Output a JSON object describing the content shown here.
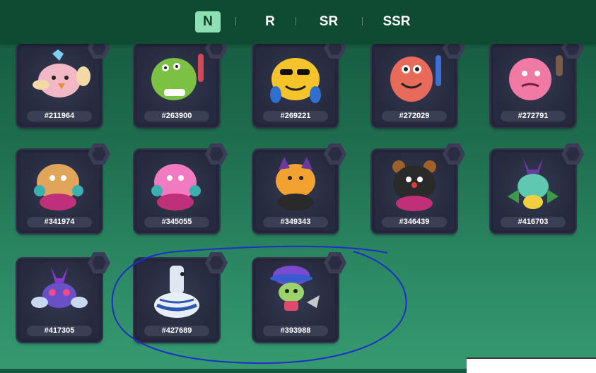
{
  "tabs": [
    {
      "label": "N",
      "active": true
    },
    {
      "label": "R",
      "active": false
    },
    {
      "label": "SR",
      "active": false
    },
    {
      "label": "SSR",
      "active": false
    }
  ],
  "cards": [
    {
      "id": "#211964",
      "creature": "pink-bird-icon",
      "color": "#f2b8c6"
    },
    {
      "id": "#263900",
      "creature": "green-furry-monster-icon",
      "color": "#7cc044"
    },
    {
      "id": "#269221",
      "creature": "yellow-sunglasses-monster-icon",
      "color": "#f4c42a"
    },
    {
      "id": "#272029",
      "creature": "red-spotted-monster-icon",
      "color": "#e86a5a"
    },
    {
      "id": "#272791",
      "creature": "pink-spiky-monster-icon",
      "color": "#f07aa4"
    },
    {
      "id": "#341974",
      "creature": "tan-boxer-monster-icon",
      "color": "#e0a45a"
    },
    {
      "id": "#345055",
      "creature": "pink-boxer-monster-icon",
      "color": "#f27ac0"
    },
    {
      "id": "#349343",
      "creature": "orange-cat-monster-icon",
      "color": "#f2a230"
    },
    {
      "id": "#346439",
      "creature": "black-bear-monster-icon",
      "color": "#2a2a2a"
    },
    {
      "id": "#416703",
      "creature": "teal-beetle-icon",
      "color": "#5fc8b0"
    },
    {
      "id": "#417305",
      "creature": "purple-fly-icon",
      "color": "#6a50c8"
    },
    {
      "id": "#427689",
      "creature": "porcelain-vase-bird-icon",
      "color": "#e6eef6"
    },
    {
      "id": "#393988",
      "creature": "green-mushroom-hat-icon",
      "color": "#9ad46a"
    }
  ],
  "annotation": {
    "color": "#1f2ec8"
  }
}
